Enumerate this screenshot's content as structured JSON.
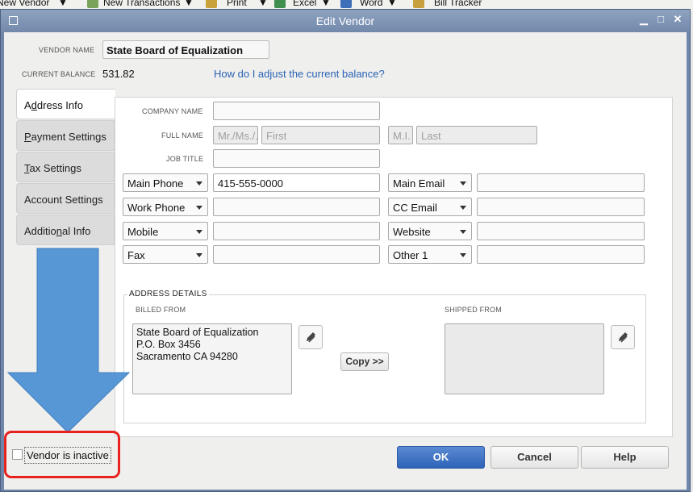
{
  "background_toolbar": {
    "items": [
      "New Vendor",
      "New Transactions",
      "Print",
      "Excel",
      "Word",
      "Bill Tracker"
    ]
  },
  "dialog": {
    "title": "Edit Vendor",
    "vendor_name_label": "VENDOR NAME",
    "vendor_name": "State Board of Equalization",
    "current_balance_label": "CURRENT BALANCE",
    "current_balance": "531.82",
    "balance_link": "How do I adjust the current balance?"
  },
  "tabs": [
    {
      "pre": "A",
      "u": "d",
      "post": "dress Info",
      "active": true
    },
    {
      "pre": "",
      "u": "P",
      "post": "ayment Settings",
      "active": false
    },
    {
      "pre": "",
      "u": "T",
      "post": "ax Settings",
      "active": false
    },
    {
      "pre": "Account Settin",
      "u": "g",
      "post": "s",
      "active": false
    },
    {
      "pre": "Additio",
      "u": "n",
      "post": "al Info",
      "active": false
    }
  ],
  "address_info": {
    "company_name_label": "COMPANY NAME",
    "full_name_label": "FULL NAME",
    "job_title_label": "JOB TITLE",
    "prefix_placeholder": "Mr./Ms./...",
    "first_placeholder": "First",
    "mi_placeholder": "M.I.",
    "last_placeholder": "Last",
    "phones": [
      {
        "type": "Main Phone",
        "value": "415-555-0000"
      },
      {
        "type": "Work Phone",
        "value": ""
      },
      {
        "type": "Mobile",
        "value": ""
      },
      {
        "type": "Fax",
        "value": ""
      }
    ],
    "contacts": [
      {
        "type": "Main Email",
        "value": ""
      },
      {
        "type": "CC Email",
        "value": ""
      },
      {
        "type": "Website",
        "value": ""
      },
      {
        "type": "Other 1",
        "value": ""
      }
    ]
  },
  "address_details": {
    "title": "ADDRESS DETAILS",
    "billed_from_label": "BILLED FROM",
    "billed_from_lines": [
      "State Board of Equalization",
      "P.O. Box 3456",
      "Sacramento CA 94280"
    ],
    "shipped_from_label": "SHIPPED FROM",
    "copy_button": "Copy >>"
  },
  "footer": {
    "inactive_label": "Vendor is inactive",
    "ok": "OK",
    "cancel": "Cancel",
    "help": "Help"
  },
  "colors": {
    "annotation_arrow": "#4a8fd2",
    "annotation_box": "#e8231f",
    "primary_button": "#2e63b7"
  }
}
